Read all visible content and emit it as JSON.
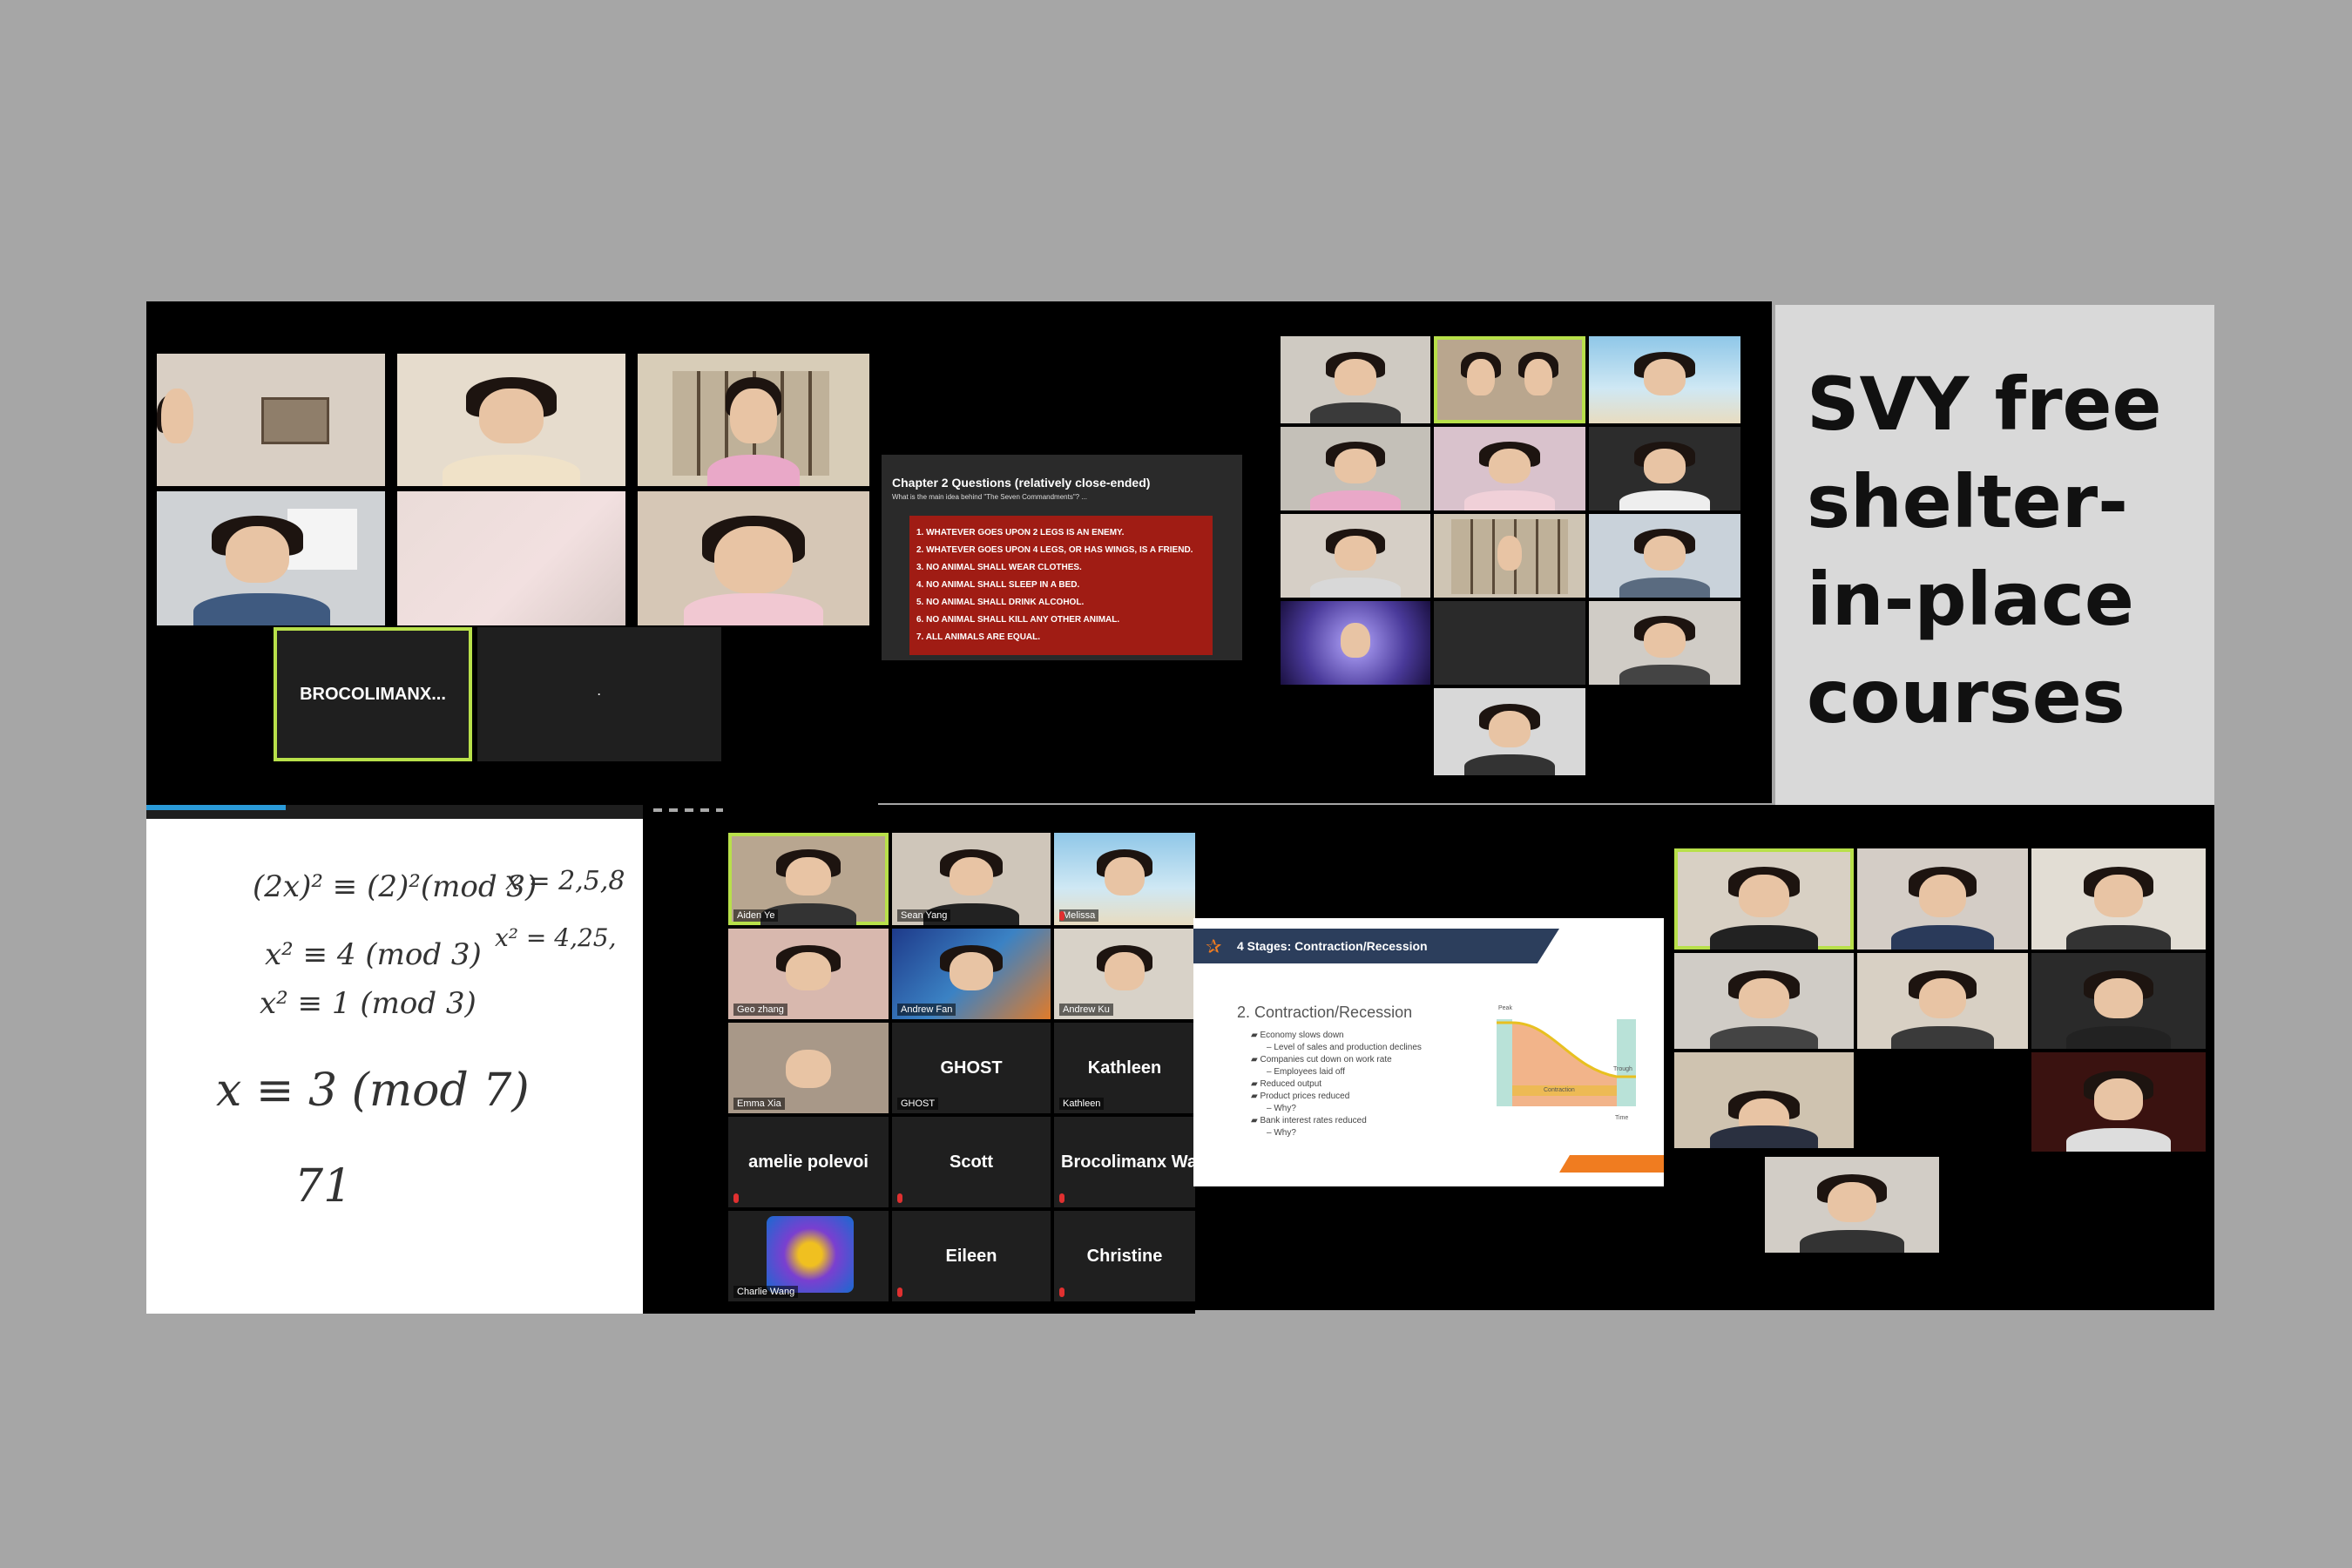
{
  "banner": {
    "title": "SVY free shelter-in-place courses"
  },
  "panel1": {
    "named_tile": "BROCOLIMANX...",
    "blank_tile": "·"
  },
  "chapter_slide": {
    "title": "Chapter 2 Questions (relatively close-ended)",
    "subtitle": "What is the main idea behind \"The Seven Commandments\"? ...",
    "commandments": [
      "1. WHATEVER GOES UPON 2 LEGS IS AN ENEMY.",
      "2. WHATEVER GOES UPON 4 LEGS, OR HAS WINGS, IS A FRIEND.",
      "3. NO ANIMAL SHALL WEAR CLOTHES.",
      "4. NO ANIMAL SHALL SLEEP IN A BED.",
      "5. NO ANIMAL SHALL DRINK ALCOHOL.",
      "6. NO ANIMAL SHALL KILL ANY OTHER ANIMAL.",
      "7. ALL ANIMALS ARE EQUAL."
    ]
  },
  "whiteboard": {
    "lines": [
      "(2x)² ≡ (2)²(mod 3)",
      "x = 2,5,8",
      "x² ≡ 4 (mod 3)",
      "x² = 4,25,",
      "x² ≡ 1 (mod 3)",
      "x ≡ 3 (mod 7)",
      "71"
    ]
  },
  "gallery": {
    "participants": [
      {
        "name": "Aiden Ye",
        "label": ""
      },
      {
        "name": "Sean Yang",
        "label": ""
      },
      {
        "name": "Melissa",
        "label": ""
      },
      {
        "name": "Geo zhang",
        "label": ""
      },
      {
        "name": "Andrew Fan",
        "label": ""
      },
      {
        "name": "Andrew Ku",
        "label": ""
      },
      {
        "name": "Emma Xia",
        "label": ""
      },
      {
        "name": "GHOST",
        "label": "GHOST"
      },
      {
        "name": "Kathleen",
        "label": "Kathleen"
      },
      {
        "name": "",
        "label": "amelie polevoi"
      },
      {
        "name": "",
        "label": "Scott"
      },
      {
        "name": "",
        "label": "Brocolimanx Want"
      },
      {
        "name": "Charlie Wang",
        "label": ""
      },
      {
        "name": "",
        "label": "Eileen"
      },
      {
        "name": "",
        "label": "Christine"
      }
    ]
  },
  "econ_slide": {
    "header": "4 Stages: Contraction/Recession",
    "heading": "2.  Contraction/Recession",
    "bullets": [
      "Economy slows down",
      "Level of sales and production declines",
      "Companies cut down on work rate",
      "Employees laid off",
      "Reduced output",
      "Product prices reduced",
      "Why?",
      "Bank interest rates reduced",
      "Why?"
    ],
    "chart": {
      "peak_label": "Peak",
      "trough_label": "Trough",
      "phase_label": "Contraction",
      "time_label": "Time"
    }
  },
  "colors": {
    "page_bg": "#a6a6a6",
    "highlight": "#b8e04a",
    "slide_red": "#a01c14"
  }
}
